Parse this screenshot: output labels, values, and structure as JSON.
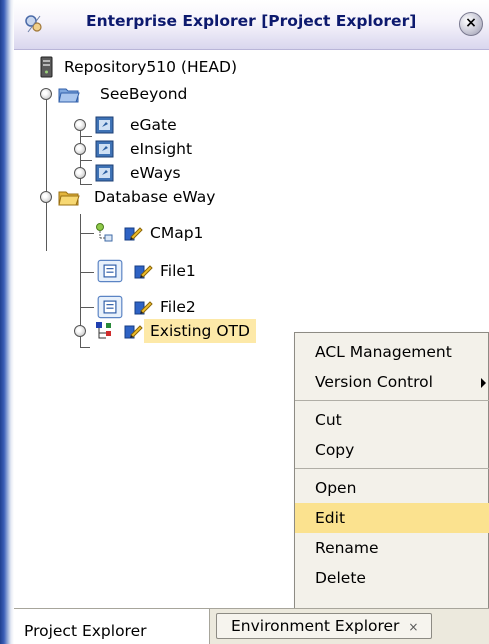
{
  "window": {
    "title": "Enterprise Explorer [Project Explorer]",
    "close_glyph": "×"
  },
  "tree": {
    "repository": "Repository510 (HEAD)",
    "seebeyond": "SeeBeyond",
    "egate": "eGate",
    "einsight": "eInsight",
    "eways": "eWays",
    "database_eway": "Database eWay",
    "cmap1": "CMap1",
    "file1": "File1",
    "file2": "File2",
    "existing_otd": "Existing OTD"
  },
  "context_menu": {
    "acl_management": "ACL Management",
    "version_control": "Version Control",
    "cut": "Cut",
    "copy": "Copy",
    "open": "Open",
    "edit": "Edit",
    "rename": "Rename",
    "delete": "Delete",
    "highlighted_item": "Edit"
  },
  "tabs": {
    "project_explorer": "Project Explorer",
    "environment_explorer": "Environment Explorer",
    "environment_close": "×"
  },
  "colors": {
    "title_text": "#0d1a6e",
    "selection": "#fde9a8",
    "menu_hover": "#fbe28f",
    "menu_background": "#f3f1ea"
  },
  "icons": {
    "title": "explorer-icon",
    "repository": "server-icon",
    "seebeyond": "open-folder-icon",
    "project": "project-icon",
    "database_eway": "open-folder-icon",
    "cmap": "connectivity-map-icon",
    "file": "file-eway-icon",
    "otd": "otd-icon",
    "checkout": "checked-out-pencil-icon"
  }
}
